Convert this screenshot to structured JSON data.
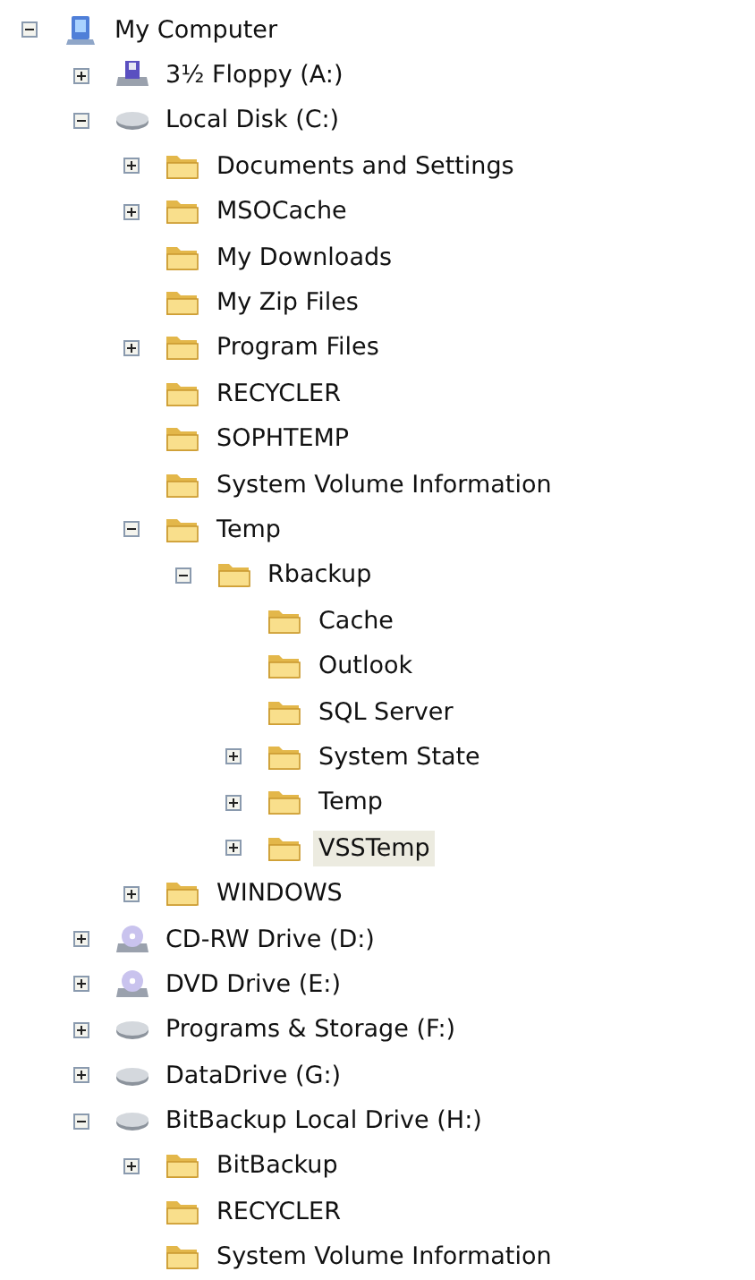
{
  "tree": [
    {
      "label": "My Computer",
      "kind": "computer",
      "expanded": true,
      "selected": false,
      "children": [
        {
          "label": "3½ Floppy (A:)",
          "kind": "floppy",
          "expanded": false,
          "selected": false
        },
        {
          "label": "Local Disk (C:)",
          "kind": "disk",
          "expanded": true,
          "selected": false,
          "children": [
            {
              "label": "Documents and Settings",
              "kind": "folder",
              "expanded": false,
              "selected": false
            },
            {
              "label": "MSOCache",
              "kind": "folder",
              "expanded": false,
              "selected": false
            },
            {
              "label": "My Downloads",
              "kind": "folder",
              "selected": false
            },
            {
              "label": "My Zip Files",
              "kind": "folder",
              "selected": false
            },
            {
              "label": "Program Files",
              "kind": "folder",
              "expanded": false,
              "selected": false
            },
            {
              "label": "RECYCLER",
              "kind": "folder",
              "selected": false
            },
            {
              "label": "SOPHTEMP",
              "kind": "folder",
              "selected": false
            },
            {
              "label": "System Volume Information",
              "kind": "folder",
              "selected": false
            },
            {
              "label": "Temp",
              "kind": "folder",
              "expanded": true,
              "selected": false,
              "children": [
                {
                  "label": "Rbackup",
                  "kind": "folder",
                  "expanded": true,
                  "selected": false,
                  "children": [
                    {
                      "label": "Cache",
                      "kind": "folder",
                      "selected": false
                    },
                    {
                      "label": "Outlook",
                      "kind": "folder",
                      "selected": false
                    },
                    {
                      "label": "SQL Server",
                      "kind": "folder",
                      "selected": false
                    },
                    {
                      "label": "System State",
                      "kind": "folder",
                      "expanded": false,
                      "selected": false
                    },
                    {
                      "label": "Temp",
                      "kind": "folder",
                      "expanded": false,
                      "selected": false
                    },
                    {
                      "label": "VSSTemp",
                      "kind": "folder",
                      "expanded": false,
                      "selected": true
                    }
                  ]
                }
              ]
            },
            {
              "label": "WINDOWS",
              "kind": "folder",
              "expanded": false,
              "selected": false
            }
          ]
        },
        {
          "label": "CD-RW Drive (D:)",
          "kind": "cdrom",
          "expanded": false,
          "selected": false
        },
        {
          "label": "DVD Drive (E:)",
          "kind": "cdrom",
          "expanded": false,
          "selected": false
        },
        {
          "label": "Programs & Storage (F:)",
          "kind": "disk",
          "expanded": false,
          "selected": false
        },
        {
          "label": "DataDrive (G:)",
          "kind": "disk",
          "expanded": false,
          "selected": false
        },
        {
          "label": "BitBackup Local Drive (H:)",
          "kind": "disk",
          "expanded": true,
          "selected": false,
          "children": [
            {
              "label": "BitBackup",
              "kind": "folder",
              "expanded": false,
              "selected": false
            },
            {
              "label": "RECYCLER",
              "kind": "folder",
              "selected": false
            },
            {
              "label": "System Volume Information",
              "kind": "folder",
              "selected": false
            }
          ]
        }
      ]
    }
  ]
}
